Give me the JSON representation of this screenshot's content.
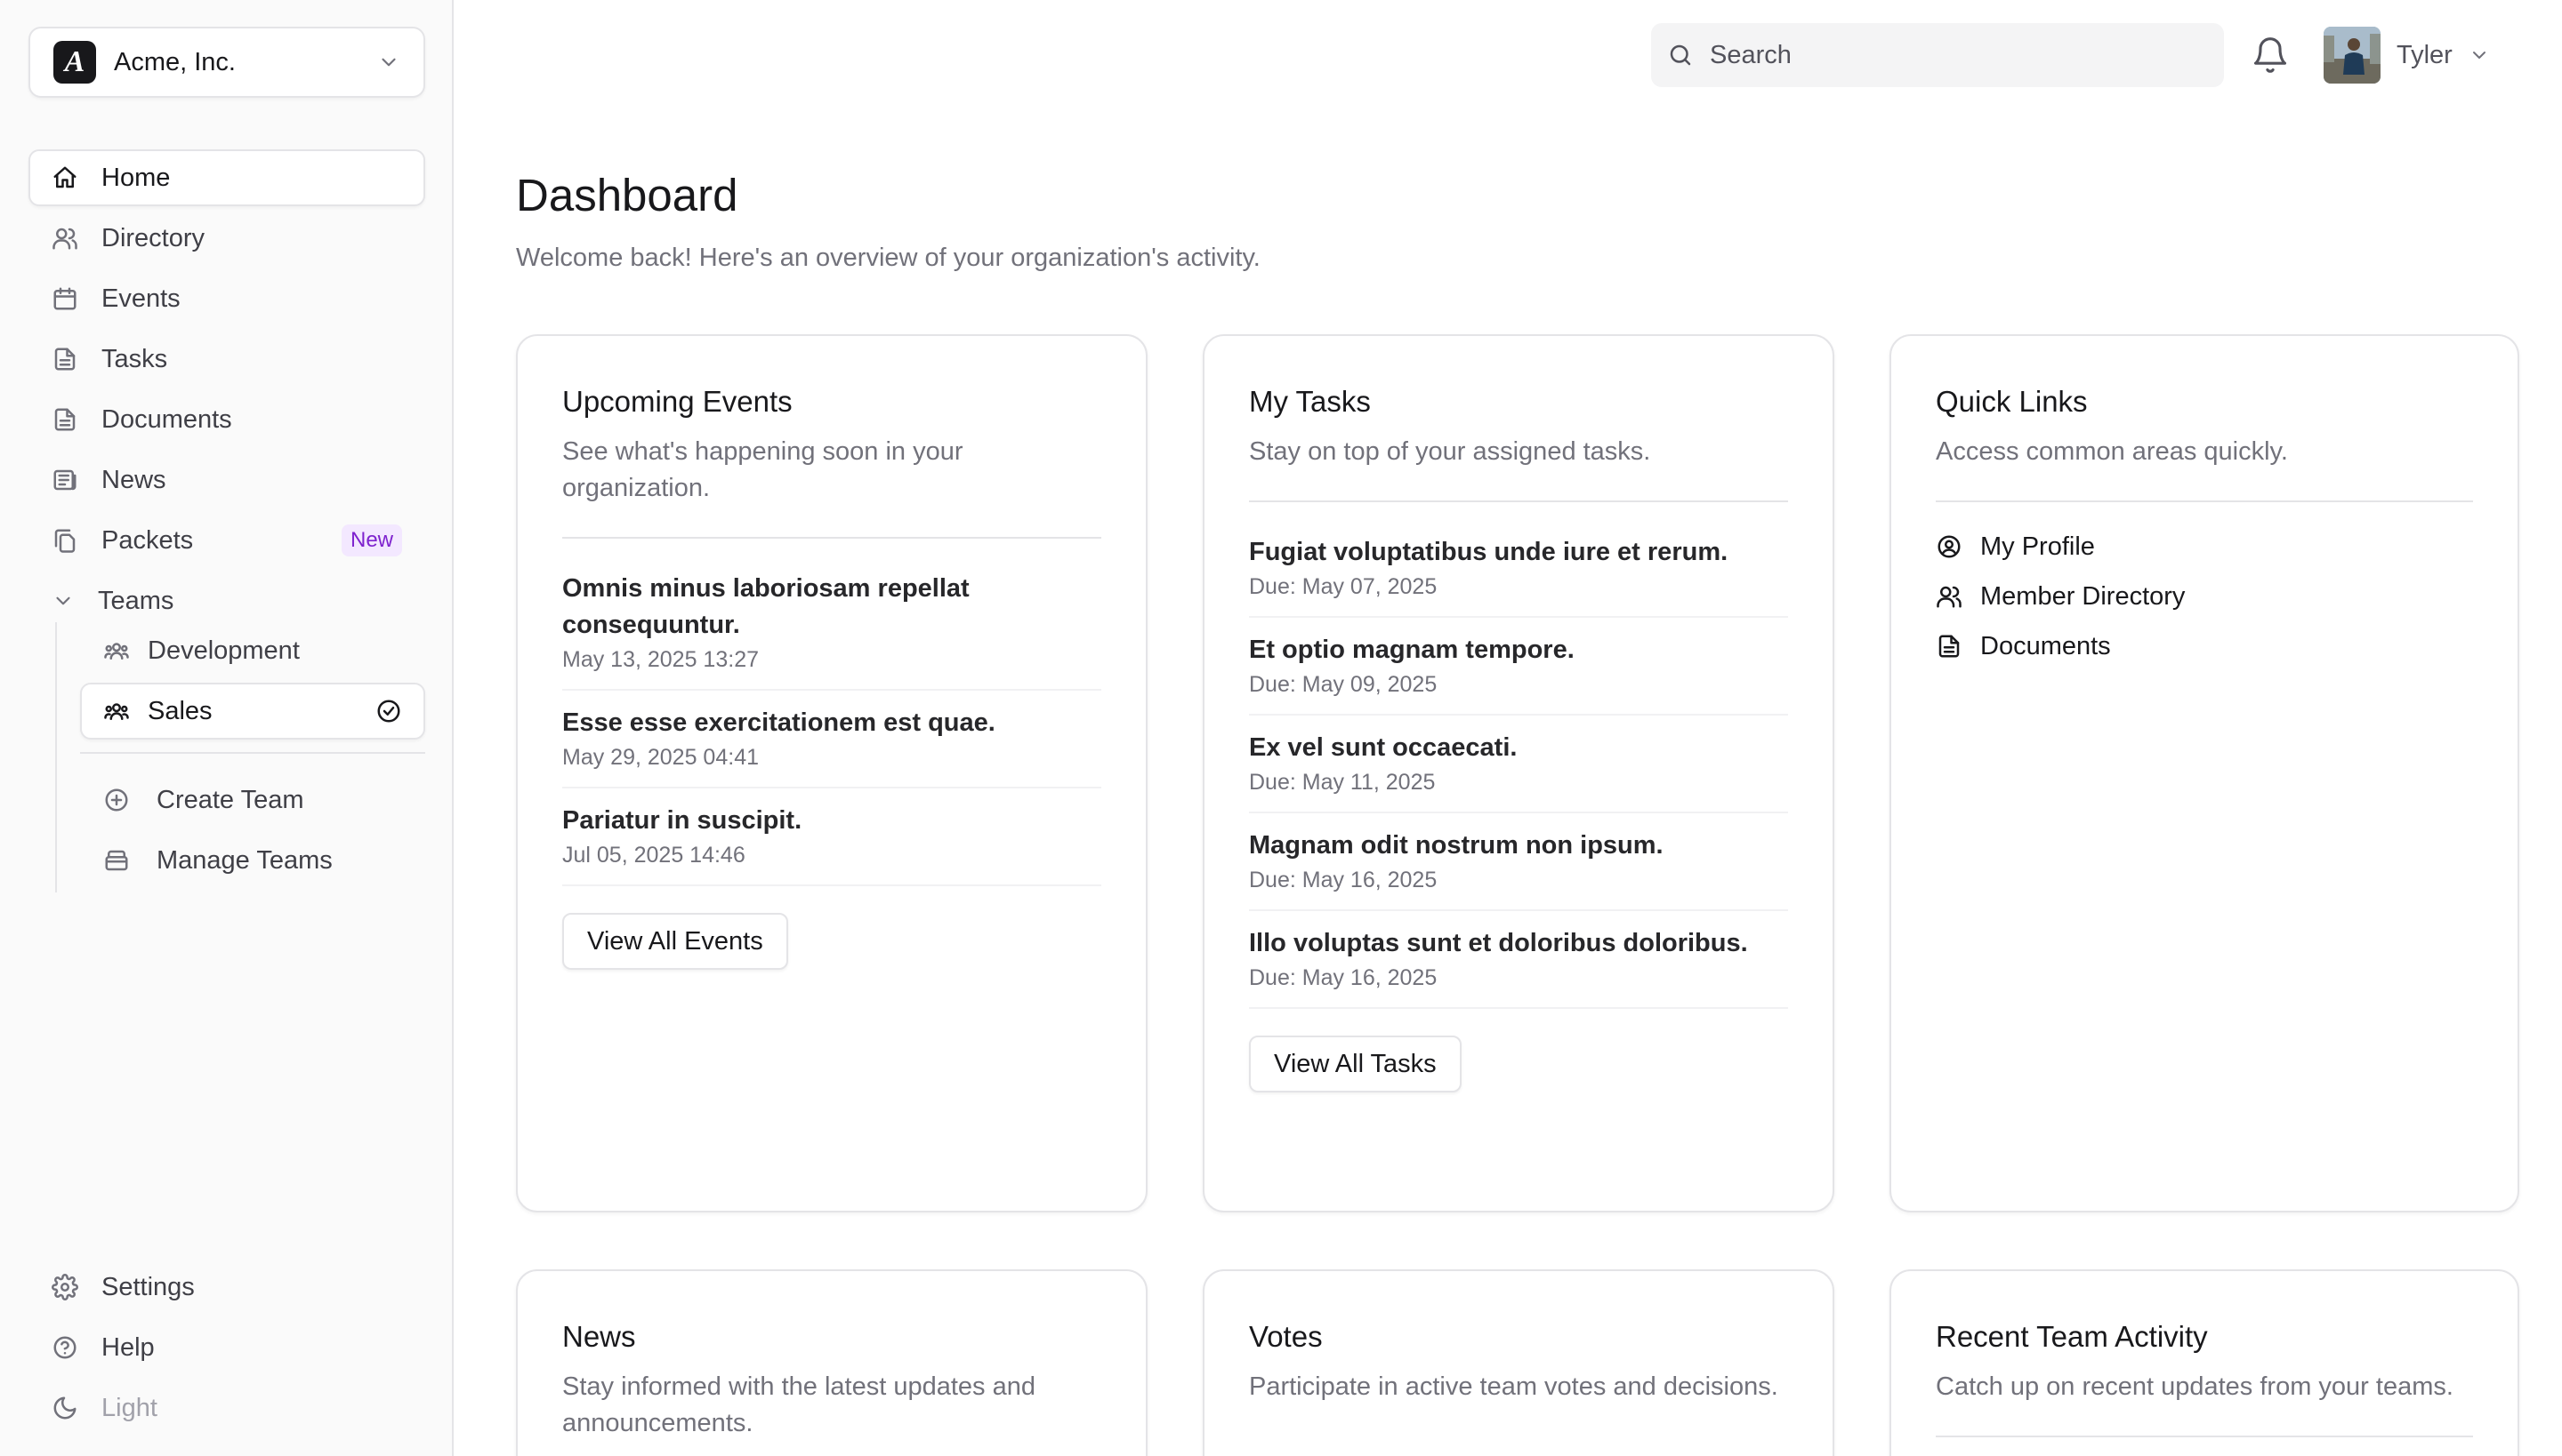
{
  "org": {
    "logo_letter": "A",
    "name": "Acme, Inc."
  },
  "nav": {
    "items": [
      {
        "label": "Home",
        "icon": "home-icon"
      },
      {
        "label": "Directory",
        "icon": "users-icon"
      },
      {
        "label": "Events",
        "icon": "calendar-icon"
      },
      {
        "label": "Tasks",
        "icon": "file-icon"
      },
      {
        "label": "Documents",
        "icon": "file-icon"
      },
      {
        "label": "News",
        "icon": "newspaper-icon"
      },
      {
        "label": "Packets",
        "icon": "files-icon",
        "badge": "New"
      }
    ],
    "teams_label": "Teams",
    "teams": [
      {
        "label": "Development",
        "icon": "team-icon"
      },
      {
        "label": "Sales",
        "icon": "team-icon"
      }
    ],
    "team_actions": [
      {
        "label": "Create Team",
        "icon": "plus-circle-icon"
      },
      {
        "label": "Manage Teams",
        "icon": "archive-icon"
      }
    ],
    "bottom": [
      {
        "label": "Settings",
        "icon": "gear-icon"
      },
      {
        "label": "Help",
        "icon": "help-circle-icon"
      },
      {
        "label": "Light",
        "icon": "moon-icon"
      }
    ]
  },
  "topbar": {
    "search_placeholder": "Search",
    "user_name": "Tyler"
  },
  "page": {
    "title": "Dashboard",
    "subtitle": "Welcome back! Here's an overview of your organization's activity."
  },
  "events": {
    "title": "Upcoming Events",
    "description": "See what's happening soon in your organization.",
    "items": [
      {
        "title": "Omnis minus laboriosam repellat consequuntur.",
        "date": "May 13, 2025 13:27"
      },
      {
        "title": "Esse esse exercitationem est quae.",
        "date": "May 29, 2025 04:41"
      },
      {
        "title": "Pariatur in suscipit.",
        "date": "Jul 05, 2025 14:46"
      }
    ],
    "button": "View All Events"
  },
  "tasks": {
    "title": "My Tasks",
    "description": "Stay on top of your assigned tasks.",
    "items": [
      {
        "title": "Fugiat voluptatibus unde iure et rerum.",
        "due": "Due: May 07, 2025"
      },
      {
        "title": "Et optio magnam tempore.",
        "due": "Due: May 09, 2025"
      },
      {
        "title": "Ex vel sunt occaecati.",
        "due": "Due: May 11, 2025"
      },
      {
        "title": "Magnam odit nostrum non ipsum.",
        "due": "Due: May 16, 2025"
      },
      {
        "title": "Illo voluptas sunt et doloribus doloribus.",
        "due": "Due: May 16, 2025"
      }
    ],
    "button": "View All Tasks"
  },
  "quick_links": {
    "title": "Quick Links",
    "description": "Access common areas quickly.",
    "items": [
      {
        "label": "My Profile",
        "icon": "user-circle-icon"
      },
      {
        "label": "Member Directory",
        "icon": "users-icon"
      },
      {
        "label": "Documents",
        "icon": "file-icon"
      }
    ]
  },
  "news": {
    "title": "News",
    "description": "Stay informed with the latest updates and announcements."
  },
  "votes": {
    "title": "Votes",
    "description": "Participate in active team votes and decisions."
  },
  "activity": {
    "title": "Recent Team Activity",
    "description": "Catch up on recent updates from your teams."
  }
}
